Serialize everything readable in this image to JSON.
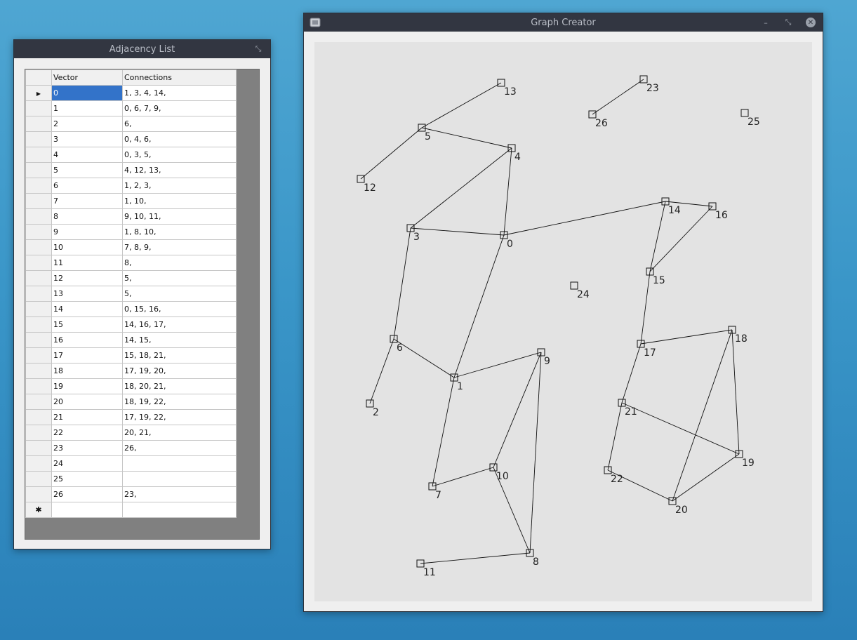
{
  "adjacency_window": {
    "title": "Adjacency List",
    "restore_glyph": "⤡",
    "columns": [
      "Vector",
      "Connections"
    ],
    "current_row_marker": "▶",
    "new_row_marker": "✱",
    "rows": [
      {
        "vector": "0",
        "connections": "1, 3, 4, 14,"
      },
      {
        "vector": "1",
        "connections": "0, 6, 7, 9,"
      },
      {
        "vector": "2",
        "connections": "6,"
      },
      {
        "vector": "3",
        "connections": "0, 4, 6,"
      },
      {
        "vector": "4",
        "connections": "0, 3, 5,"
      },
      {
        "vector": "5",
        "connections": "4, 12, 13,"
      },
      {
        "vector": "6",
        "connections": "1, 2, 3,"
      },
      {
        "vector": "7",
        "connections": "1, 10,"
      },
      {
        "vector": "8",
        "connections": "9, 10, 11,"
      },
      {
        "vector": "9",
        "connections": "1, 8, 10,"
      },
      {
        "vector": "10",
        "connections": "7, 8, 9,"
      },
      {
        "vector": "11",
        "connections": "8,"
      },
      {
        "vector": "12",
        "connections": "5,"
      },
      {
        "vector": "13",
        "connections": "5,"
      },
      {
        "vector": "14",
        "connections": "0, 15, 16,"
      },
      {
        "vector": "15",
        "connections": "14, 16, 17,"
      },
      {
        "vector": "16",
        "connections": "14, 15,"
      },
      {
        "vector": "17",
        "connections": "15, 18, 21,"
      },
      {
        "vector": "18",
        "connections": "17, 19, 20,"
      },
      {
        "vector": "19",
        "connections": "18, 20, 21,"
      },
      {
        "vector": "20",
        "connections": "18, 19, 22,"
      },
      {
        "vector": "21",
        "connections": "17, 19, 22,"
      },
      {
        "vector": "22",
        "connections": "20, 21,"
      },
      {
        "vector": "23",
        "connections": "26,"
      },
      {
        "vector": "24",
        "connections": ""
      },
      {
        "vector": "25",
        "connections": ""
      },
      {
        "vector": "26",
        "connections": "23,"
      }
    ]
  },
  "graph_window": {
    "title": "Graph Creator",
    "minimize_glyph": "–",
    "restore_glyph": "⤡",
    "close_glyph": "✕",
    "vertex_labels": [
      "0",
      "1",
      "2",
      "3",
      "4",
      "5",
      "6",
      "7",
      "8",
      "9",
      "10",
      "11",
      "12",
      "13",
      "14",
      "15",
      "16",
      "17",
      "18",
      "19",
      "20",
      "21",
      "22",
      "23",
      "24",
      "25",
      "26"
    ]
  },
  "colors": {
    "titlebar": "#323641",
    "selection": "#3373c9",
    "canvas": "#e3e3e3",
    "desktop": "#3a96c8"
  }
}
